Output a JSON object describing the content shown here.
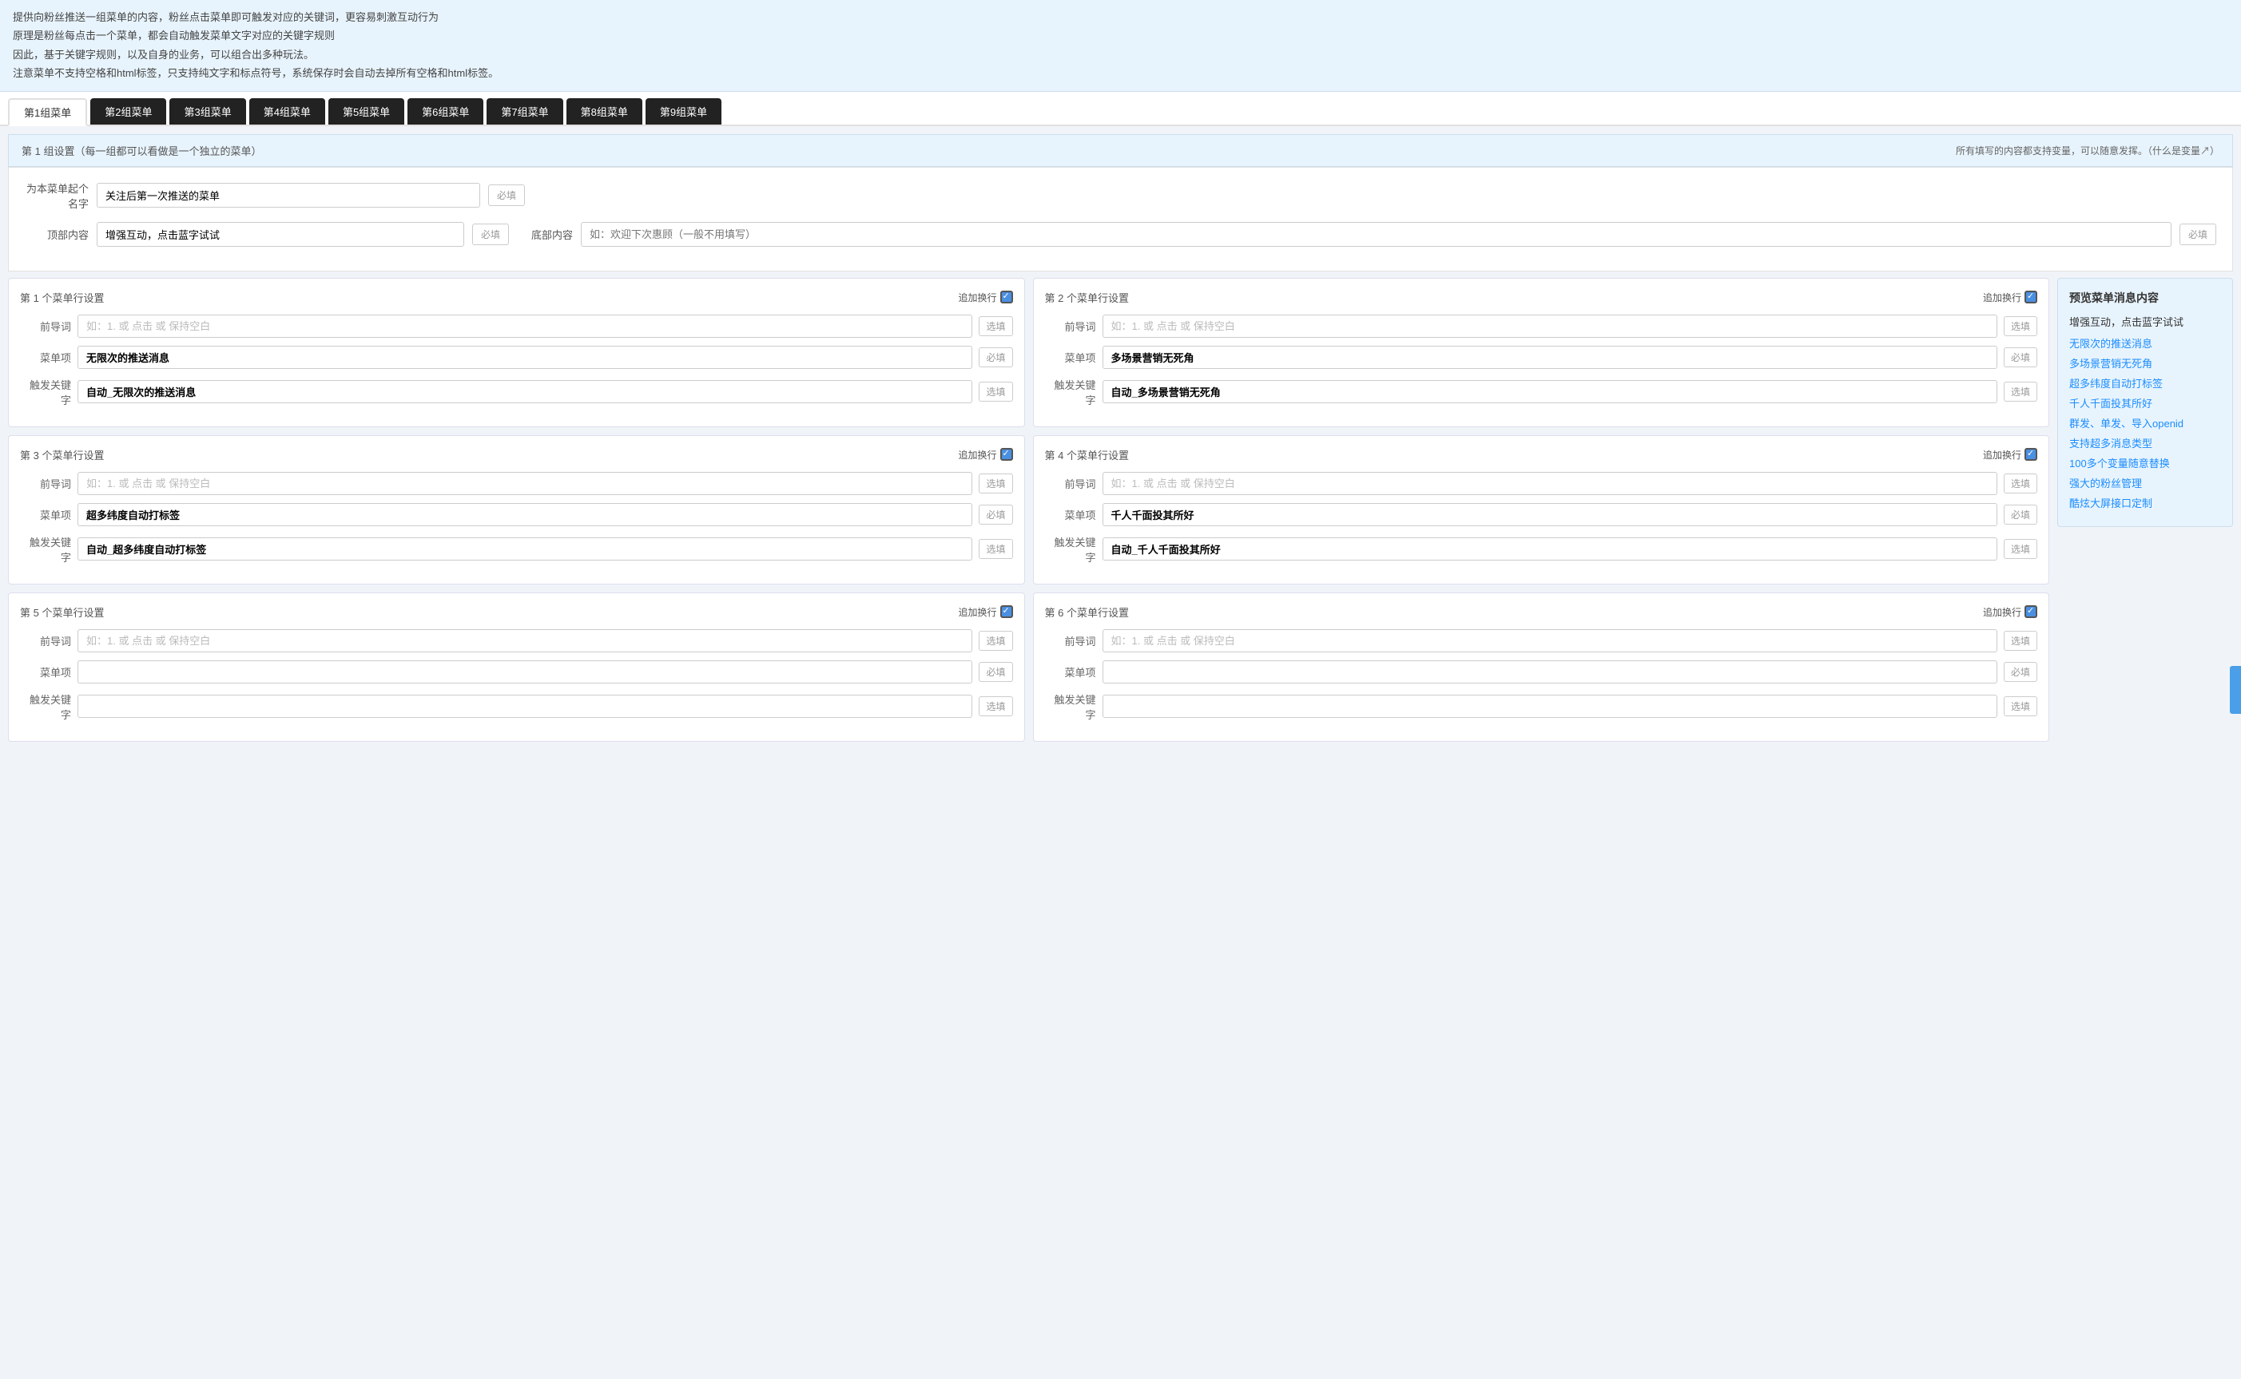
{
  "topInfo": {
    "lines": [
      "提供向粉丝推送一组菜单的内容，粉丝点击菜单即可触发对应的关键词，更容易刺激互动行为",
      "原理是粉丝每点击一个菜单，都会自动触发菜单文字对应的关键字规则",
      "因此，基于关键字规则，以及自身的业务，可以组合出多种玩法。",
      "注意菜单不支持空格和html标签，只支持纯文字和标点符号，系统保存时会自动去掉所有空格和html标签。"
    ]
  },
  "tabs": [
    {
      "label": "第1组菜单",
      "active": true
    },
    {
      "label": "第2组菜单",
      "active": false
    },
    {
      "label": "第3组菜单",
      "active": false
    },
    {
      "label": "第4组菜单",
      "active": false
    },
    {
      "label": "第5组菜单",
      "active": false
    },
    {
      "label": "第6组菜单",
      "active": false
    },
    {
      "label": "第7组菜单",
      "active": false
    },
    {
      "label": "第8组菜单",
      "active": false
    },
    {
      "label": "第9组菜单",
      "active": false
    }
  ],
  "sectionHeader": {
    "left": "第 1 组设置（每一组都可以看做是一个独立的菜单）",
    "right": "所有填写的内容都支持变量，可以随意发挥。（什么是变量↗）"
  },
  "nameField": {
    "label": "为本菜单起个名字",
    "value": "关注后第一次推送的菜单",
    "placeholder": "必填",
    "badgeLabel": "必填"
  },
  "topContent": {
    "label": "顶部内容",
    "value": "增强互动，点击蓝字试试",
    "placeholder": "必填",
    "badgeLabel": "必填"
  },
  "bottomContent": {
    "label": "底部内容",
    "value": "",
    "placeholder": "如：欢迎下次惠顾（一般不用填写）",
    "badgeLabel": "必填"
  },
  "menuCards": [
    {
      "id": 1,
      "title": "第 1 个菜单行设置",
      "addNewline": "追加换行",
      "fields": {
        "prefix": {
          "label": "前导词",
          "value": "",
          "placeholder": "如：1. 或 点击 或 保持空白",
          "badge": "选填"
        },
        "menuItem": {
          "label": "菜单项",
          "value": "无限次的推送消息",
          "placeholder": "",
          "badge": "必填"
        },
        "keyword": {
          "label": "触发关键字",
          "value": "自动_无限次的推送消息",
          "placeholder": "",
          "badge": "选填"
        }
      }
    },
    {
      "id": 2,
      "title": "第 2 个菜单行设置",
      "addNewline": "追加换行",
      "fields": {
        "prefix": {
          "label": "前导词",
          "value": "",
          "placeholder": "如：1. 或 点击 或 保持空白",
          "badge": "选填"
        },
        "menuItem": {
          "label": "菜单项",
          "value": "多场景营销无死角",
          "placeholder": "",
          "badge": "必填"
        },
        "keyword": {
          "label": "触发关键字",
          "value": "自动_多场景营销无死角",
          "placeholder": "",
          "badge": "选填"
        }
      }
    },
    {
      "id": 3,
      "title": "第 3 个菜单行设置",
      "addNewline": "追加换行",
      "fields": {
        "prefix": {
          "label": "前导词",
          "value": "",
          "placeholder": "如：1. 或 点击 或 保持空白",
          "badge": "选填"
        },
        "menuItem": {
          "label": "菜单项",
          "value": "超多纬度自动打标签",
          "placeholder": "",
          "badge": "必填"
        },
        "keyword": {
          "label": "触发关键字",
          "value": "自动_超多纬度自动打标签",
          "placeholder": "",
          "badge": "选填"
        }
      }
    },
    {
      "id": 4,
      "title": "第 4 个菜单行设置",
      "addNewline": "追加换行",
      "fields": {
        "prefix": {
          "label": "前导词",
          "value": "",
          "placeholder": "如：1. 或 点击 或 保持空白",
          "badge": "选填"
        },
        "menuItem": {
          "label": "菜单项",
          "value": "千人千面投其所好",
          "placeholder": "",
          "badge": "必填"
        },
        "keyword": {
          "label": "触发关键字",
          "value": "自动_千人千面投其所好",
          "placeholder": "",
          "badge": "选填"
        }
      }
    },
    {
      "id": 5,
      "title": "第 5 个菜单行设置",
      "addNewline": "追加换行",
      "fields": {
        "prefix": {
          "label": "前导词",
          "value": "",
          "placeholder": "如：1. 或 点击 或 保持空白",
          "badge": "选填"
        },
        "menuItem": {
          "label": "菜单项",
          "value": "",
          "placeholder": "",
          "badge": "必填"
        },
        "keyword": {
          "label": "触发关键字",
          "value": "",
          "placeholder": "",
          "badge": "选填"
        }
      }
    },
    {
      "id": 6,
      "title": "第 6 个菜单行设置",
      "addNewline": "追加换行",
      "fields": {
        "prefix": {
          "label": "前导词",
          "value": "",
          "placeholder": "如：1. 或 点击 或 保持空白",
          "badge": "选填"
        },
        "menuItem": {
          "label": "菜单项",
          "value": "",
          "placeholder": "",
          "badge": "必填"
        },
        "keyword": {
          "label": "触发关键字",
          "value": "",
          "placeholder": "",
          "badge": "选填"
        }
      }
    }
  ],
  "preview": {
    "title": "预览菜单消息内容",
    "topText": "增强互动，点击蓝字试试",
    "items": [
      {
        "text": "无限次的推送消息",
        "blue": true
      },
      {
        "text": "多场景营销无死角",
        "blue": true
      },
      {
        "text": "超多纬度自动打标签",
        "blue": true
      },
      {
        "text": "千人千面投其所好",
        "blue": true
      },
      {
        "text": "群发、单发、导入openid",
        "blue": true
      },
      {
        "text": "支持超多消息类型",
        "blue": true
      },
      {
        "text": "100多个变量随意替换",
        "blue": true
      },
      {
        "text": "强大的粉丝管理",
        "blue": true
      },
      {
        "text": "酷炫大屏接口定制",
        "blue": true
      }
    ]
  }
}
